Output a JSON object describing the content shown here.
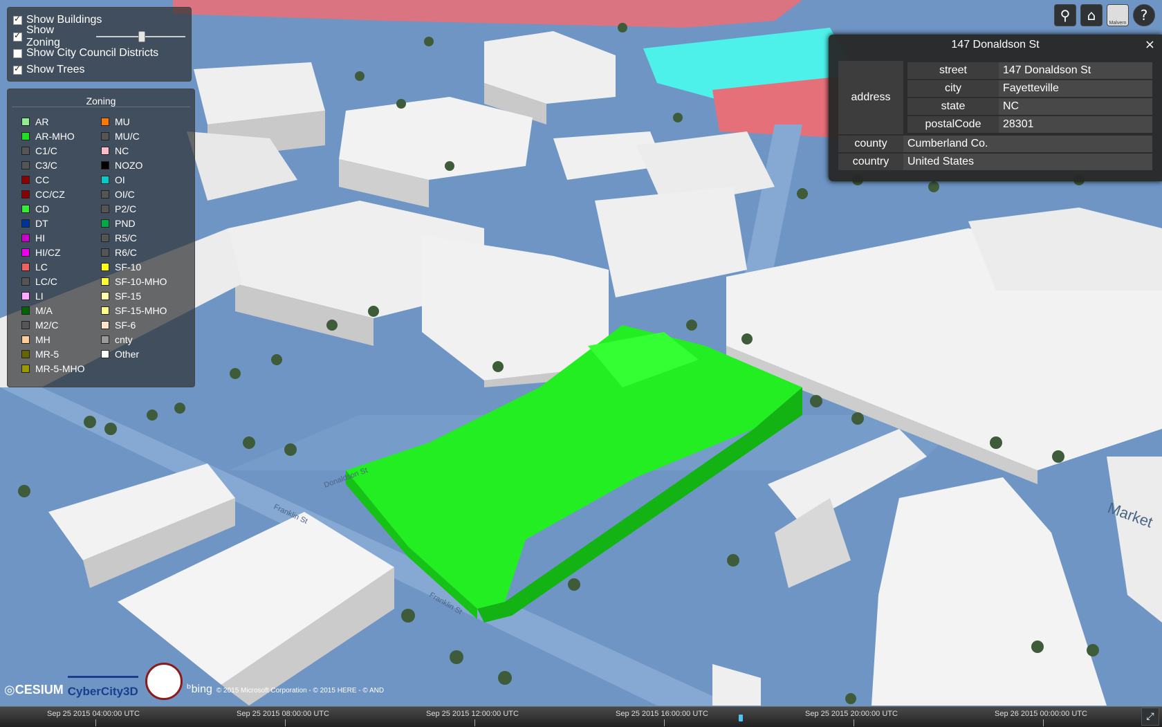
{
  "layers": {
    "show_buildings": {
      "label": "Show Buildings",
      "checked": true
    },
    "show_zoning": {
      "label": "Show Zoning",
      "checked": true,
      "opacity": 0.5
    },
    "show_council": {
      "label": "Show City Council Districts",
      "checked": false
    },
    "show_trees": {
      "label": "Show Trees",
      "checked": true
    }
  },
  "legend": {
    "title": "Zoning",
    "columns": [
      [
        {
          "label": "AR",
          "color": "#90ee90"
        },
        {
          "label": "AR-MHO",
          "color": "#22dd22"
        },
        {
          "label": "C1/C",
          "color": "#555555"
        },
        {
          "label": "C3/C",
          "color": "#555555"
        },
        {
          "label": "CC",
          "color": "#8b0000"
        },
        {
          "label": "CC/CZ",
          "color": "#8b0000"
        },
        {
          "label": "CD",
          "color": "#33ee33"
        },
        {
          "label": "DT",
          "color": "#003399"
        },
        {
          "label": "HI",
          "color": "#cc00cc"
        },
        {
          "label": "HI/CZ",
          "color": "#ee00ee"
        },
        {
          "label": "LC",
          "color": "#f06060"
        },
        {
          "label": "LC/C",
          "color": "#555555"
        },
        {
          "label": "LI",
          "color": "#ffaaff"
        },
        {
          "label": "M/A",
          "color": "#006400"
        },
        {
          "label": "M2/C",
          "color": "#555555"
        },
        {
          "label": "MH",
          "color": "#ffcc99"
        },
        {
          "label": "MR-5",
          "color": "#666600"
        },
        {
          "label": "MR-5-MHO",
          "color": "#999900"
        }
      ],
      [
        {
          "label": "MU",
          "color": "#ff7700"
        },
        {
          "label": "MU/C",
          "color": "#555555"
        },
        {
          "label": "NC",
          "color": "#ffbbcc"
        },
        {
          "label": "NOZO",
          "color": "#000000"
        },
        {
          "label": "OI",
          "color": "#00cccc"
        },
        {
          "label": "OI/C",
          "color": "#555555"
        },
        {
          "label": "P2/C",
          "color": "#555555"
        },
        {
          "label": "PND",
          "color": "#00aa44"
        },
        {
          "label": "R5/C",
          "color": "#555555"
        },
        {
          "label": "R6/C",
          "color": "#555555"
        },
        {
          "label": "SF-10",
          "color": "#ffff00"
        },
        {
          "label": "SF-10-MHO",
          "color": "#ffff33"
        },
        {
          "label": "SF-15",
          "color": "#ffffaa"
        },
        {
          "label": "SF-15-MHO",
          "color": "#ffff88"
        },
        {
          "label": "SF-6",
          "color": "#ffe4cc"
        },
        {
          "label": "cnty",
          "color": "#999999"
        },
        {
          "label": "Other",
          "color": "#ffffff"
        }
      ]
    ]
  },
  "toolbar": {
    "search_glyph": "⚲",
    "home_glyph": "⌂",
    "basemap_label": "Malvern",
    "help_glyph": "?"
  },
  "infobox": {
    "title": "147 Donaldson St",
    "close_glyph": "×",
    "address_label": "address",
    "address": {
      "street_key": "street",
      "street": "147 Donaldson St",
      "city_key": "city",
      "city": "Fayetteville",
      "state_key": "state",
      "state": "NC",
      "postal_key": "postalCode",
      "postal": "28301"
    },
    "county_key": "county",
    "county": "Cumberland Co.",
    "country_key": "country",
    "country": "United States"
  },
  "map_labels": {
    "franklin_1": "Franklin St",
    "franklin_2": "Franklin St",
    "donaldson": "Donaldson St",
    "market": "Market"
  },
  "credits": {
    "cesium": "CESIUM",
    "cybercity": "CyberCity3D",
    "bing": "bing",
    "attribution": "© 2015 Microsoft Corporation - © 2015 HERE - © AND"
  },
  "timeline": {
    "labels": [
      "Sep 25 2015 04:00:00 UTC",
      "Sep 25 2015 08:00:00 UTC",
      "Sep 25 2015 12:00:00 UTC",
      "Sep 25 2015 16:00:00 UTC",
      "Sep 25 2015 20:00:00 UTC",
      "Sep 26 2015 00:00:00 UTC"
    ]
  },
  "colors": {
    "ground": "#6e95c4",
    "road": "#86a9d3",
    "building": "#efefef",
    "building_side": "#c9c9c9",
    "highlight": "#22ee22",
    "highlight_side": "#15c215",
    "tree": "#3f5c3a"
  }
}
